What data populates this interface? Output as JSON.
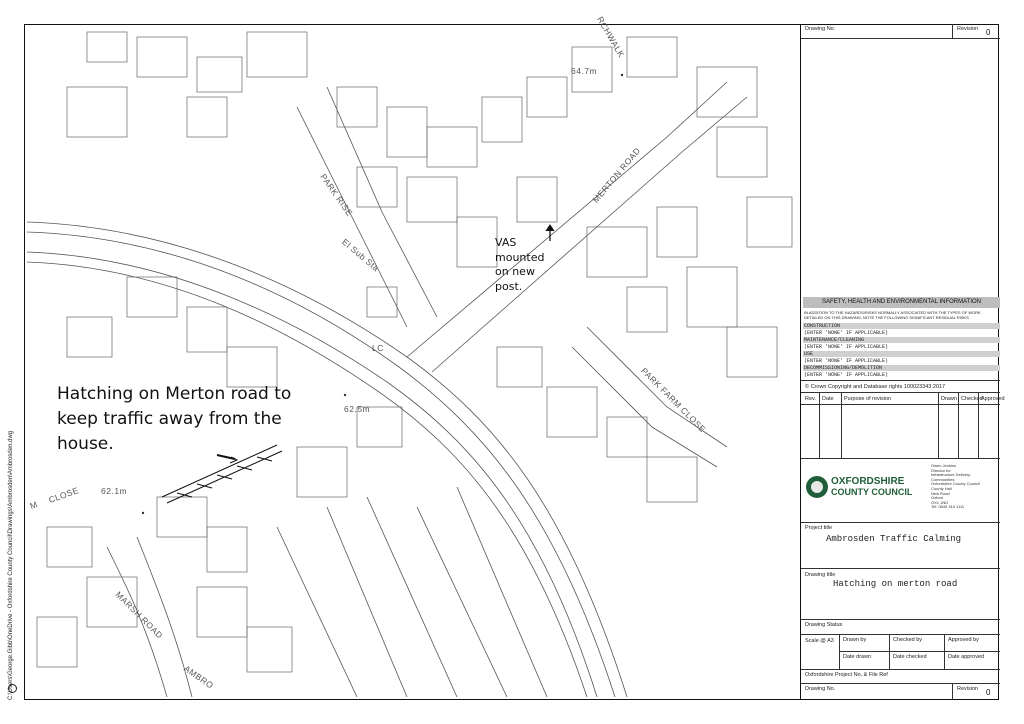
{
  "file_path_vertical": "C:\\Users\\George.Gibb\\OneDrive - Oxfordshire County Council\\Drawings\\Ambrosden\\Ambrosden.dwg",
  "map": {
    "street_labels": {
      "park_rise": "PARK RISE",
      "el_sub_sta": "El Sub Sta",
      "merton_road": "MERTON ROAD",
      "park_farm_close": "PARK FARM CLOSE",
      "marsh_road": "MARSH ROAD",
      "close": "CLOSE",
      "m_close": "M",
      "rchwalk": "RCHWALK",
      "ambro": "AMBRO",
      "lc": "LC"
    },
    "spot_heights": {
      "h1": "64.7m",
      "h2": "62.5m",
      "h3": "62.1m"
    },
    "annotations": {
      "vas_lines": [
        "VAS",
        "mounted",
        "on new",
        "post."
      ],
      "hatching_lines": [
        "Hatching on Merton road to",
        "keep traffic away from the",
        "house."
      ]
    }
  },
  "title_block": {
    "drawing_no_label": "Drawing No.",
    "revision_label": "Revision",
    "revision_value": "0",
    "she": {
      "header": "SAFETY, HEALTH AND ENVIRONMENTAL INFORMATION",
      "intro": "IN ADDITION TO THE HAZARDS/RISKS NORMALLY ASSOCIATED WITH THE TYPES OF WORK DETAILED ON THIS DRAWING, NOTE THE FOLLOWING SIGNIFICANT RESIDUAL RISKS",
      "sections": [
        {
          "title": "CONSTRUCTION",
          "value": "(ENTER 'NONE' IF APPLICABLE)"
        },
        {
          "title": "MAINTENANCE/CLEANING",
          "value": "(ENTER 'NONE' IF APPLICABLE)"
        },
        {
          "title": "USE",
          "value": "(ENTER 'NONE' IF APPLICABLE)"
        },
        {
          "title": "DECOMMISSIONING/DEMOLITION",
          "value": "(ENTER 'NONE' IF APPLICABLE)"
        }
      ]
    },
    "copyright": "© Crown Copyright and Database rights 100023343 2017",
    "rev_table_headers": {
      "rev": "Rev.",
      "date": "Date",
      "purpose": "Purpose of revision",
      "drawn": "Drawn",
      "checked": "Checked",
      "approved": "Approved"
    },
    "org": {
      "line1": "OXFORDSHIRE",
      "line2": "COUNTY COUNCIL",
      "address": [
        "Owen Jenkins",
        "Director for",
        "Infrastructure Delivery",
        "Communities",
        "Oxfordshire County Council",
        "County Hall",
        "New Road",
        "Oxford",
        "OX1 1ND",
        "Tel: 0845 310 1111"
      ]
    },
    "project_title_label": "Project title",
    "project_title": "Ambrosden Traffic Calming",
    "drawing_title_label": "Drawing title",
    "drawing_title": "Hatching on merton road",
    "drawing_status_label": "Drawing Status",
    "scale_label": "Scale @ A3",
    "drawn_by_label": "Drawn by",
    "checked_by_label": "Checked by",
    "approved_by_label": "Approved by",
    "date_drawn_label": "Date drawn",
    "date_checked_label": "Date checked",
    "date_approved_label": "Date approved",
    "project_no_label": "Oxfordshire Project No. & File Ref",
    "drawing_no_label_bottom": "Drawing No.",
    "revision_label_bottom": "Revision",
    "revision_value_bottom": "0"
  }
}
